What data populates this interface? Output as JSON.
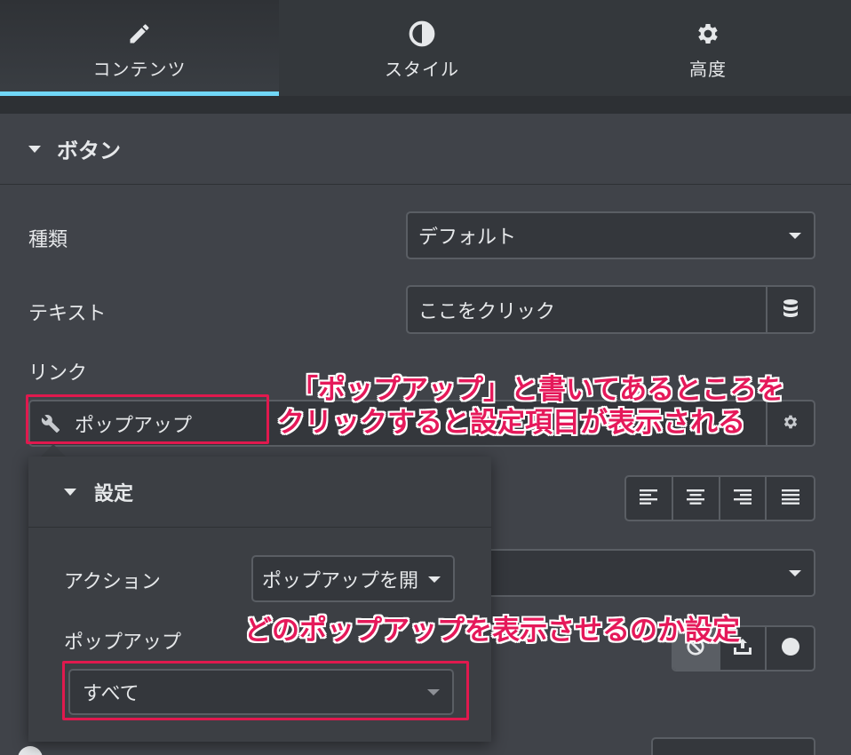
{
  "tabs": [
    {
      "label": "コンテンツ",
      "icon": "pencil-icon",
      "active": true
    },
    {
      "label": "スタイル",
      "icon": "contrast-icon",
      "active": false
    },
    {
      "label": "高度",
      "icon": "gear-icon",
      "active": false
    }
  ],
  "section": {
    "title": "ボタン"
  },
  "fields": {
    "type_label": "種類",
    "type_value": "デフォルト",
    "text_label": "テキスト",
    "text_value": "ここをクリック",
    "link_label": "リンク",
    "link_value": "ポップアップ"
  },
  "popover": {
    "title": "設定",
    "action_label": "アクション",
    "action_value": "ポップアップを開",
    "popup_label": "ポップアップ",
    "popup_value": "すべて"
  },
  "annotations": {
    "line1": "「ポップアップ」と書いてあるところを",
    "line2": "クリックすると設定項目が表示される",
    "line3": "どのポップアップを表示させるのか設定"
  },
  "colors": {
    "accent": "#71d7f7",
    "highlight": "#e0194e",
    "annotation_text": "#e5195a",
    "background": "#404349"
  }
}
